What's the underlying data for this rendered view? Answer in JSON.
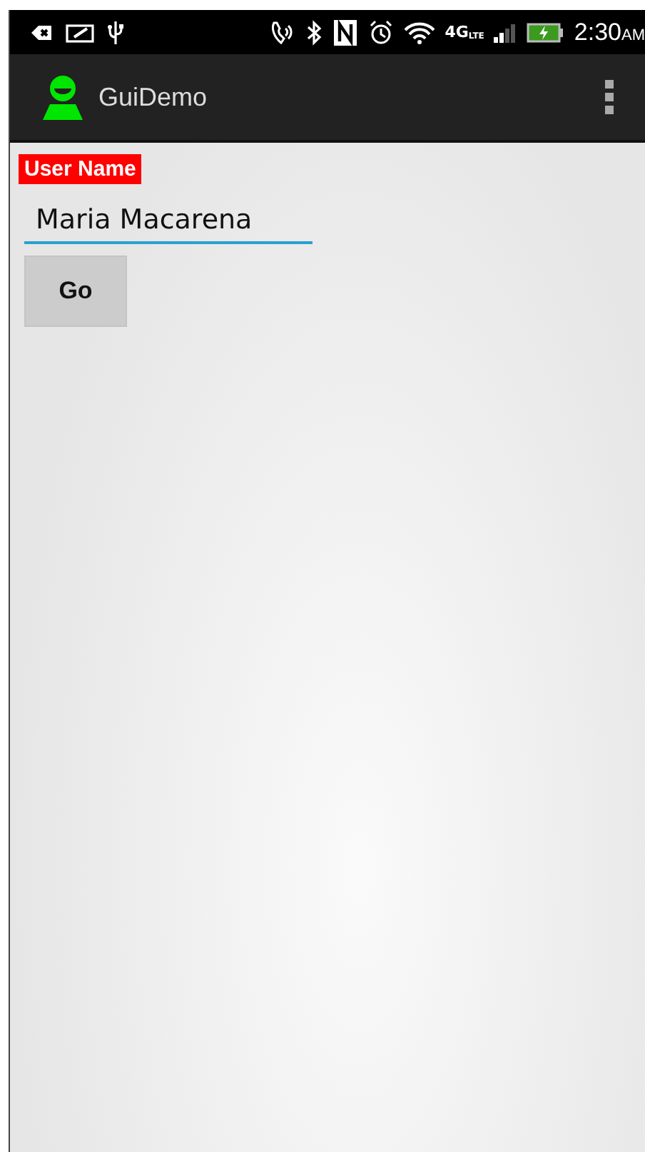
{
  "status_bar": {
    "network": "4G",
    "network_sub": "LTE",
    "time": "2:30",
    "meridiem": "AM"
  },
  "app_bar": {
    "title": "GuiDemo"
  },
  "form": {
    "label": "User Name",
    "field": {
      "value": "Maria Macarena"
    },
    "button": "Go"
  }
}
